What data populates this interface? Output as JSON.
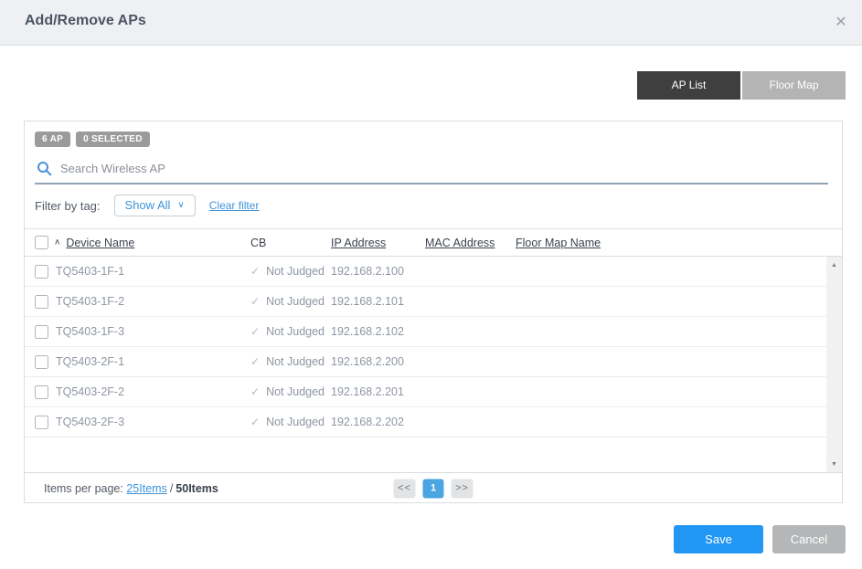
{
  "dialog": {
    "title": "Add/Remove APs",
    "close_icon": "✕"
  },
  "tabs": {
    "ap_list": "AP List",
    "floor_map": "Floor Map"
  },
  "panel": {
    "badges": {
      "ap_count": "6 AP",
      "selected_count": "0 SELECTED"
    },
    "search": {
      "placeholder": "Search Wireless AP"
    },
    "filter": {
      "label": "Filter by tag:",
      "dropdown_value": "Show All",
      "dropdown_chevron": "∨",
      "clear_link": "Clear filter"
    },
    "table": {
      "sort_indicator": "∧",
      "check_icon": "✓",
      "columns": [
        "Device Name",
        "CB",
        "IP Address",
        "MAC Address",
        "Floor Map Name"
      ],
      "rows": [
        {
          "device_name": "TQ5403-1F-1",
          "cb": "Not Judged",
          "ip": "192.168.2.100",
          "mac": "",
          "floor_map": ""
        },
        {
          "device_name": "TQ5403-1F-2",
          "cb": "Not Judged",
          "ip": "192.168.2.101",
          "mac": "",
          "floor_map": ""
        },
        {
          "device_name": "TQ5403-1F-3",
          "cb": "Not Judged",
          "ip": "192.168.2.102",
          "mac": "",
          "floor_map": ""
        },
        {
          "device_name": "TQ5403-2F-1",
          "cb": "Not Judged",
          "ip": "192.168.2.200",
          "mac": "",
          "floor_map": ""
        },
        {
          "device_name": "TQ5403-2F-2",
          "cb": "Not Judged",
          "ip": "192.168.2.201",
          "mac": "",
          "floor_map": ""
        },
        {
          "device_name": "TQ5403-2F-3",
          "cb": "Not Judged",
          "ip": "192.168.2.202",
          "mac": "",
          "floor_map": ""
        }
      ]
    },
    "scrollbar": {
      "up_arrow": "▲",
      "down_arrow": "▼"
    },
    "footer": {
      "items_per_page_label": "Items per page:",
      "page_size_link": "25Items",
      "separator": "/",
      "total_items": "50Items",
      "pagination": {
        "prev": "<<",
        "current_page": "1",
        "next": ">>"
      }
    }
  },
  "actions": {
    "save": "Save",
    "cancel": "Cancel"
  },
  "colors": {
    "accent_blue": "#2196f3",
    "link_blue": "#3e93da",
    "tab_active": "#3f3f3f",
    "tab_inactive": "#b4b4b4",
    "badge_gray": "#9b9b9b",
    "pagination_current": "#4aa5e0"
  }
}
